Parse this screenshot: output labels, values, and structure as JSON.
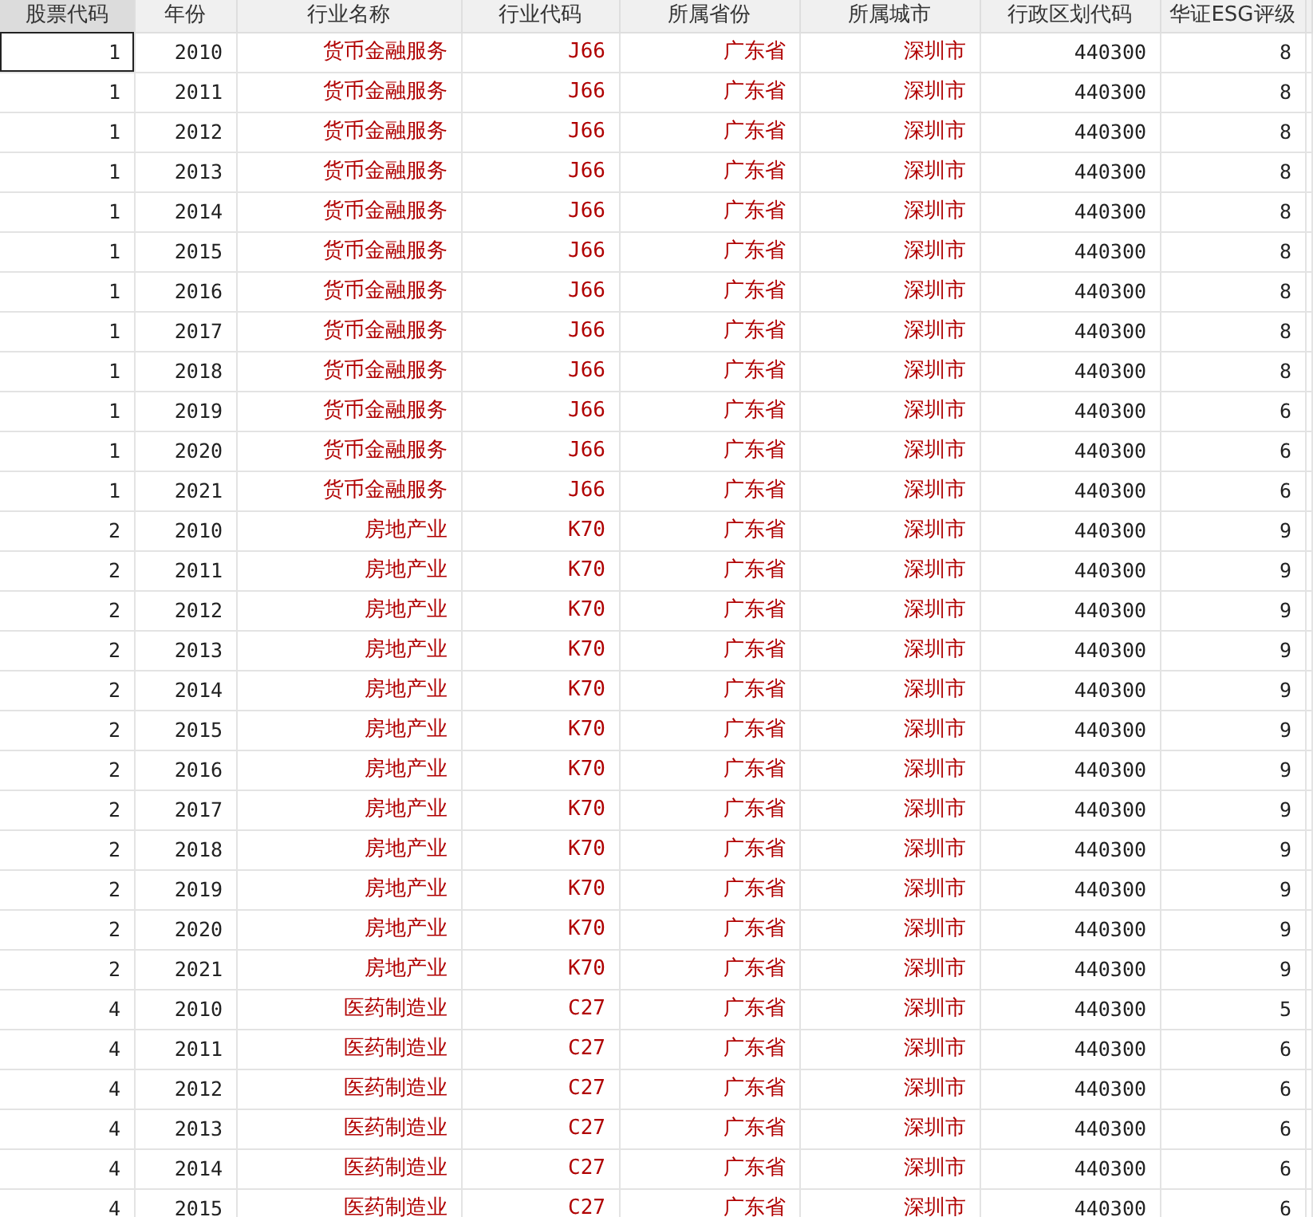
{
  "table": {
    "columns": [
      {
        "label": "股票代码",
        "kind": "number"
      },
      {
        "label": "年份",
        "kind": "number"
      },
      {
        "label": "行业名称",
        "kind": "string"
      },
      {
        "label": "行业代码",
        "kind": "string"
      },
      {
        "label": "所属省份",
        "kind": "string"
      },
      {
        "label": "所属城市",
        "kind": "string"
      },
      {
        "label": "行政区划代码",
        "kind": "number"
      },
      {
        "label": "华证ESG评级",
        "kind": "number"
      }
    ],
    "rows": [
      {
        "selected": true,
        "cells": [
          "1",
          "2010",
          "货币金融服务",
          "J66",
          "广东省",
          "深圳市",
          "440300",
          "8"
        ]
      },
      {
        "selected": false,
        "cells": [
          "1",
          "2011",
          "货币金融服务",
          "J66",
          "广东省",
          "深圳市",
          "440300",
          "8"
        ]
      },
      {
        "selected": false,
        "cells": [
          "1",
          "2012",
          "货币金融服务",
          "J66",
          "广东省",
          "深圳市",
          "440300",
          "8"
        ]
      },
      {
        "selected": false,
        "cells": [
          "1",
          "2013",
          "货币金融服务",
          "J66",
          "广东省",
          "深圳市",
          "440300",
          "8"
        ]
      },
      {
        "selected": false,
        "cells": [
          "1",
          "2014",
          "货币金融服务",
          "J66",
          "广东省",
          "深圳市",
          "440300",
          "8"
        ]
      },
      {
        "selected": false,
        "cells": [
          "1",
          "2015",
          "货币金融服务",
          "J66",
          "广东省",
          "深圳市",
          "440300",
          "8"
        ]
      },
      {
        "selected": false,
        "cells": [
          "1",
          "2016",
          "货币金融服务",
          "J66",
          "广东省",
          "深圳市",
          "440300",
          "8"
        ]
      },
      {
        "selected": false,
        "cells": [
          "1",
          "2017",
          "货币金融服务",
          "J66",
          "广东省",
          "深圳市",
          "440300",
          "8"
        ]
      },
      {
        "selected": false,
        "cells": [
          "1",
          "2018",
          "货币金融服务",
          "J66",
          "广东省",
          "深圳市",
          "440300",
          "8"
        ]
      },
      {
        "selected": false,
        "cells": [
          "1",
          "2019",
          "货币金融服务",
          "J66",
          "广东省",
          "深圳市",
          "440300",
          "6"
        ]
      },
      {
        "selected": false,
        "cells": [
          "1",
          "2020",
          "货币金融服务",
          "J66",
          "广东省",
          "深圳市",
          "440300",
          "6"
        ]
      },
      {
        "selected": false,
        "cells": [
          "1",
          "2021",
          "货币金融服务",
          "J66",
          "广东省",
          "深圳市",
          "440300",
          "6"
        ]
      },
      {
        "selected": false,
        "cells": [
          "2",
          "2010",
          "房地产业",
          "K70",
          "广东省",
          "深圳市",
          "440300",
          "9"
        ]
      },
      {
        "selected": false,
        "cells": [
          "2",
          "2011",
          "房地产业",
          "K70",
          "广东省",
          "深圳市",
          "440300",
          "9"
        ]
      },
      {
        "selected": false,
        "cells": [
          "2",
          "2012",
          "房地产业",
          "K70",
          "广东省",
          "深圳市",
          "440300",
          "9"
        ]
      },
      {
        "selected": false,
        "cells": [
          "2",
          "2013",
          "房地产业",
          "K70",
          "广东省",
          "深圳市",
          "440300",
          "9"
        ]
      },
      {
        "selected": false,
        "cells": [
          "2",
          "2014",
          "房地产业",
          "K70",
          "广东省",
          "深圳市",
          "440300",
          "9"
        ]
      },
      {
        "selected": false,
        "cells": [
          "2",
          "2015",
          "房地产业",
          "K70",
          "广东省",
          "深圳市",
          "440300",
          "9"
        ]
      },
      {
        "selected": false,
        "cells": [
          "2",
          "2016",
          "房地产业",
          "K70",
          "广东省",
          "深圳市",
          "440300",
          "9"
        ]
      },
      {
        "selected": false,
        "cells": [
          "2",
          "2017",
          "房地产业",
          "K70",
          "广东省",
          "深圳市",
          "440300",
          "9"
        ]
      },
      {
        "selected": false,
        "cells": [
          "2",
          "2018",
          "房地产业",
          "K70",
          "广东省",
          "深圳市",
          "440300",
          "9"
        ]
      },
      {
        "selected": false,
        "cells": [
          "2",
          "2019",
          "房地产业",
          "K70",
          "广东省",
          "深圳市",
          "440300",
          "9"
        ]
      },
      {
        "selected": false,
        "cells": [
          "2",
          "2020",
          "房地产业",
          "K70",
          "广东省",
          "深圳市",
          "440300",
          "9"
        ]
      },
      {
        "selected": false,
        "cells": [
          "2",
          "2021",
          "房地产业",
          "K70",
          "广东省",
          "深圳市",
          "440300",
          "9"
        ]
      },
      {
        "selected": false,
        "cells": [
          "4",
          "2010",
          "医药制造业",
          "C27",
          "广东省",
          "深圳市",
          "440300",
          "5"
        ]
      },
      {
        "selected": false,
        "cells": [
          "4",
          "2011",
          "医药制造业",
          "C27",
          "广东省",
          "深圳市",
          "440300",
          "6"
        ]
      },
      {
        "selected": false,
        "cells": [
          "4",
          "2012",
          "医药制造业",
          "C27",
          "广东省",
          "深圳市",
          "440300",
          "6"
        ]
      },
      {
        "selected": false,
        "cells": [
          "4",
          "2013",
          "医药制造业",
          "C27",
          "广东省",
          "深圳市",
          "440300",
          "6"
        ]
      },
      {
        "selected": false,
        "cells": [
          "4",
          "2014",
          "医药制造业",
          "C27",
          "广东省",
          "深圳市",
          "440300",
          "6"
        ]
      },
      {
        "selected": false,
        "cells": [
          "4",
          "2015",
          "医药制造业",
          "C27",
          "广东省",
          "深圳市",
          "440300",
          "6"
        ]
      }
    ]
  }
}
